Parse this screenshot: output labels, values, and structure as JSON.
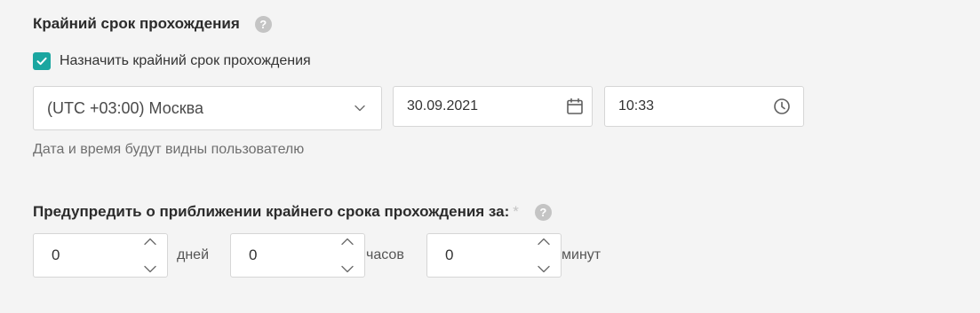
{
  "deadline": {
    "title": "Крайний срок прохождения",
    "help_icon": "question-circle-icon",
    "checkbox_label": "Назначить крайний срок прохождения",
    "checkbox_checked": true,
    "accent_color": "#1aa6a0",
    "timezone": "(UTC +03:00) Москва",
    "date": "30.09.2021",
    "time": "10:33",
    "hint": "Дата и время будут видны пользователю"
  },
  "warning": {
    "title": "Предупредить о приближении крайнего срока прохождения за:",
    "required_mark": "*",
    "days_value": "0",
    "days_unit": "дней",
    "hours_value": "0",
    "hours_unit": "часов",
    "minutes_value": "0",
    "minutes_unit": "минут"
  }
}
